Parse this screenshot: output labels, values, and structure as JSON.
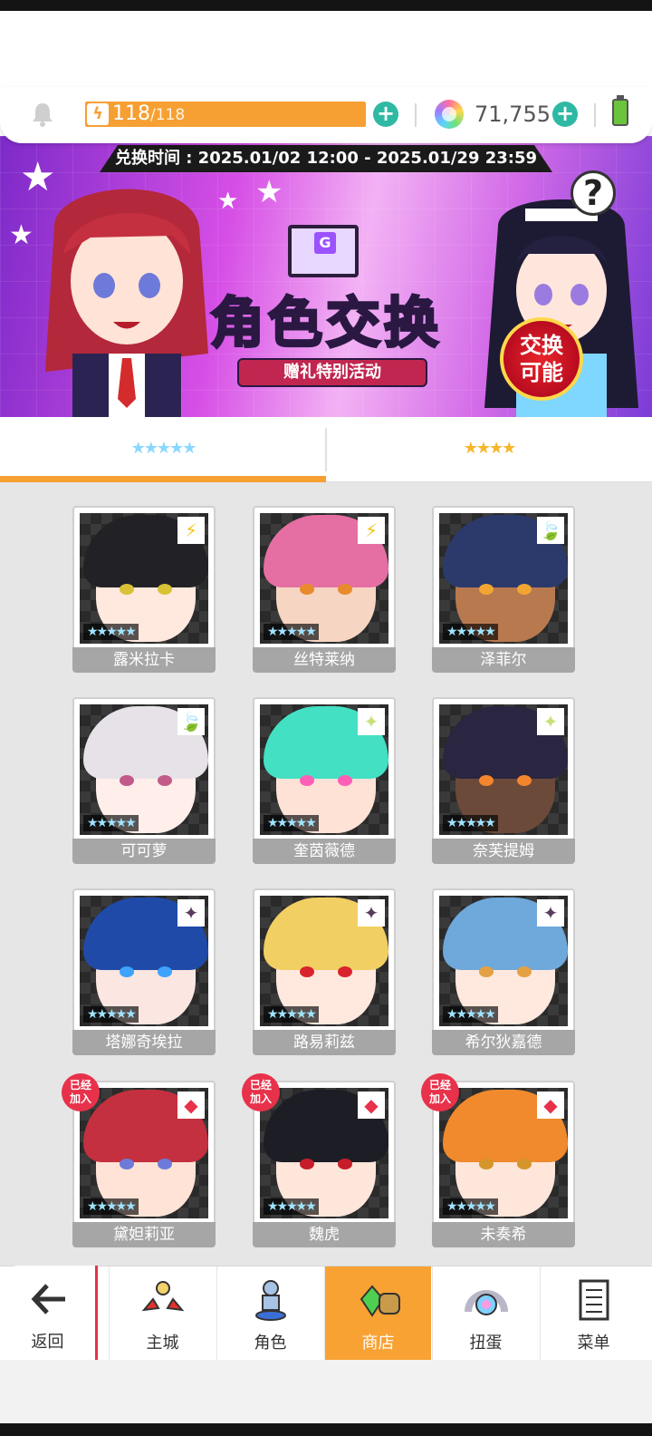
{
  "resources": {
    "energy_current": "118",
    "energy_max": "/118",
    "energy_icon": "lightning-icon",
    "gem_count": "71,755",
    "plus_label": "+"
  },
  "banner": {
    "period": "兑换时间 : 2025.01/02 12:00 - 2025.01/29 23:59",
    "title": "角色交换",
    "subtitle": "赠礼特别活动",
    "badge": "交换可能",
    "help_label": "?"
  },
  "tabs": [
    {
      "label": "★★★★★",
      "active": true
    },
    {
      "label": "★★★★",
      "active": false
    }
  ],
  "characters": [
    {
      "name": "露米拉卡",
      "element": "⚡",
      "rarity": "★★★★★",
      "joined": false
    },
    {
      "name": "丝特莱纳",
      "element": "⚡",
      "rarity": "★★★★★",
      "joined": false
    },
    {
      "name": "泽菲尔",
      "element": "🍃",
      "rarity": "★★★★★",
      "joined": false
    },
    {
      "name": "可可萝",
      "element": "🍃",
      "rarity": "★★★★★",
      "joined": false
    },
    {
      "name": "奎茵薇德",
      "element": "✦",
      "rarity": "★★★★★",
      "joined": false
    },
    {
      "name": "奈芙提姆",
      "element": "✦",
      "rarity": "★★★★★",
      "joined": false
    },
    {
      "name": "塔娜奇埃拉",
      "element": "✦",
      "rarity": "★★★★★",
      "joined": false
    },
    {
      "name": "路易莉兹",
      "element": "✦",
      "rarity": "★★★★★",
      "joined": false
    },
    {
      "name": "希尔狄嘉德",
      "element": "✦",
      "rarity": "★★★★★",
      "joined": false
    },
    {
      "name": "黛妲莉亚",
      "element": "◆",
      "rarity": "★★★★★",
      "joined": true
    },
    {
      "name": "魏虎",
      "element": "◆",
      "rarity": "★★★★★",
      "joined": true
    },
    {
      "name": "未奏希",
      "element": "◆",
      "rarity": "★★★★★",
      "joined": true
    }
  ],
  "joined_label": "已经加入",
  "nav": {
    "back": "返回",
    "items": [
      "主城",
      "角色",
      "商店",
      "扭蛋",
      "菜单"
    ],
    "active": "商店"
  },
  "colors": {
    "accent": "#f6a033",
    "plus": "#2fb9a4",
    "joined": "#e8314a",
    "name_bar": "#a6a6a6"
  }
}
